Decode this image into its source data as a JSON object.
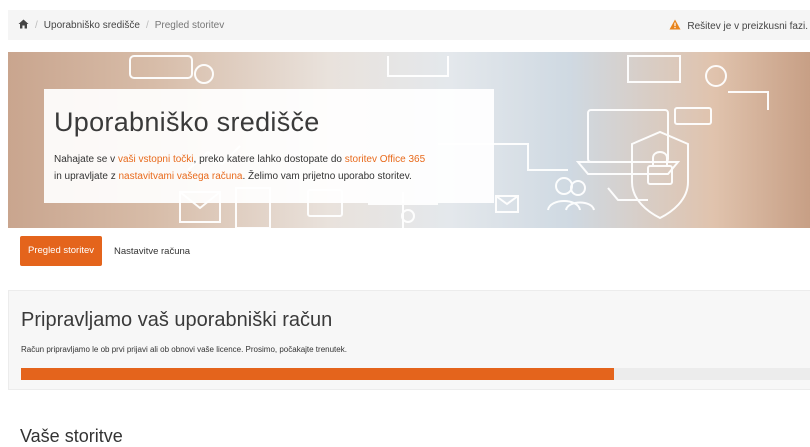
{
  "breadcrumb": {
    "home_icon": "home-icon",
    "items": [
      "Uporabniško središče",
      "Pregled storitev"
    ],
    "separator": "/"
  },
  "status": {
    "icon": "warning-icon",
    "text": "Rešitev je v preizkusni fazi."
  },
  "hero": {
    "title": "Uporabniško središče",
    "line1_a": "Nahajate se v ",
    "line1_link1": "vaši vstopni točki",
    "line1_b": ", preko katere lahko dostopate do ",
    "line1_link2": "storitev Office 365",
    "line2_a": "in upravljate z ",
    "line2_link": "nastavitvami vašega računa",
    "line2_b": ". Želimo vam prijetno uporabo storitev."
  },
  "tabs": [
    {
      "label": "Pregled storitev",
      "active": true
    },
    {
      "label": "Nastavitve računa",
      "active": false
    }
  ],
  "account_panel": {
    "title": "Pripravljamo vaš uporabniški račun",
    "text": "Račun pripravljamo le ob prvi prijavi ali ob obnovi vaše licence. Prosimo, počakajte trenutek.",
    "progress": 0.75
  },
  "services_heading": "Vaše storitve",
  "colors": {
    "accent": "#e4641c",
    "warning": "#e8841c",
    "panel_bg": "#f7f7f7"
  }
}
